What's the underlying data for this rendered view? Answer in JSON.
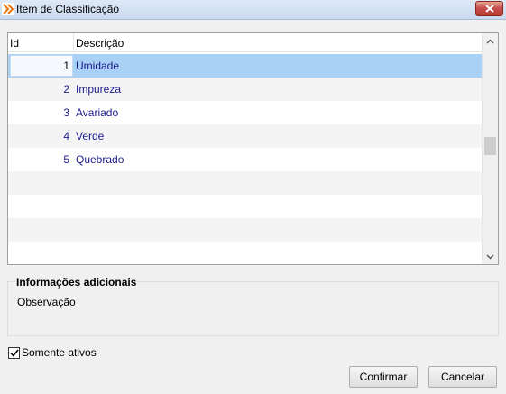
{
  "window": {
    "title": "Item de Classificação"
  },
  "grid": {
    "columns": {
      "id": "Id",
      "description": "Descrição"
    },
    "rows": [
      {
        "id": "1",
        "description": "Umidade",
        "selected": true
      },
      {
        "id": "2",
        "description": "Impureza",
        "selected": false
      },
      {
        "id": "3",
        "description": "Avariado",
        "selected": false
      },
      {
        "id": "4",
        "description": "Verde",
        "selected": false
      },
      {
        "id": "5",
        "description": "Quebrado",
        "selected": false
      }
    ]
  },
  "additional_info": {
    "title": "Informações adicionais",
    "observation_label": "Observação"
  },
  "filter": {
    "active_only_label": "Somente ativos",
    "active_only_checked": true
  },
  "buttons": {
    "confirm": "Confirmar",
    "cancel": "Cancelar"
  },
  "colors": {
    "selection": "#a9d1f5",
    "row_text": "#1a1a8a",
    "close_button": "#c75050"
  }
}
